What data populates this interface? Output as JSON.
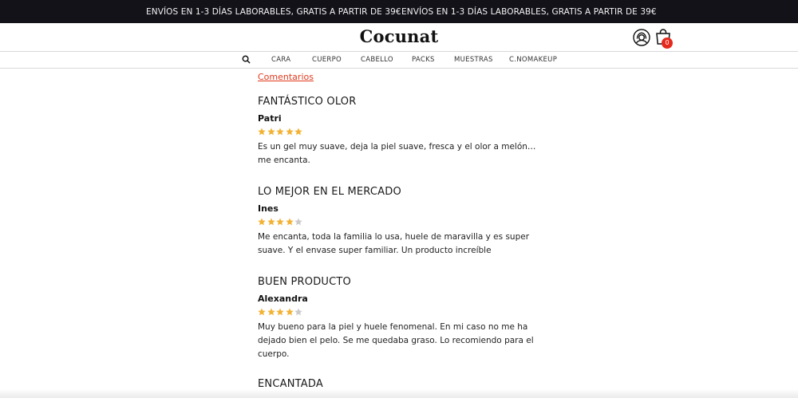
{
  "promo": {
    "text_1": "ENVÍOS EN 1-3 DÍAS LABORABLES, GRATIS A PARTIR DE 39€",
    "text_2": "ENVÍOS EN 1-3 DÍAS LABORABLES, GRATIS A PARTIR DE 39€"
  },
  "header": {
    "logo": "Cocunat",
    "cart_count": "0",
    "account_icon": "account-icon",
    "cart_icon": "cart-icon"
  },
  "nav": {
    "search_icon": "search-icon",
    "items": [
      "CARA",
      "CUERPO",
      "CABELLO",
      "PACKS",
      "MUESTRAS",
      "C.NOMAKEUP"
    ]
  },
  "comments": {
    "link_label": "Comentarios",
    "reviews": [
      {
        "title": "FANTÁSTICO OLOR",
        "author": "Patri",
        "rating": 5,
        "text": "Es un gel muy suave, deja la piel suave, fresca y el olor a melón…me encanta."
      },
      {
        "title": "LO MEJOR EN EL MERCADO",
        "author": "Ines",
        "rating": 4,
        "text": "Me encanta, toda la familia lo usa, huele de maravilla y es super suave. Y el envase super familiar. Un producto increíble"
      },
      {
        "title": "BUEN PRODUCTO",
        "author": "Alexandra",
        "rating": 4,
        "text": "Muy bueno para la piel y huele fenomenal. En mi caso no me ha dejado bien el pelo. Se me quedaba graso. Lo recomiendo para el cuerpo."
      },
      {
        "title": "ENCANTADA"
      }
    ]
  },
  "colors": {
    "promo_bg": "#141219",
    "accent_red": "#e03a1e",
    "star_filled": "#f2b233",
    "star_empty": "#c9c9c9"
  }
}
